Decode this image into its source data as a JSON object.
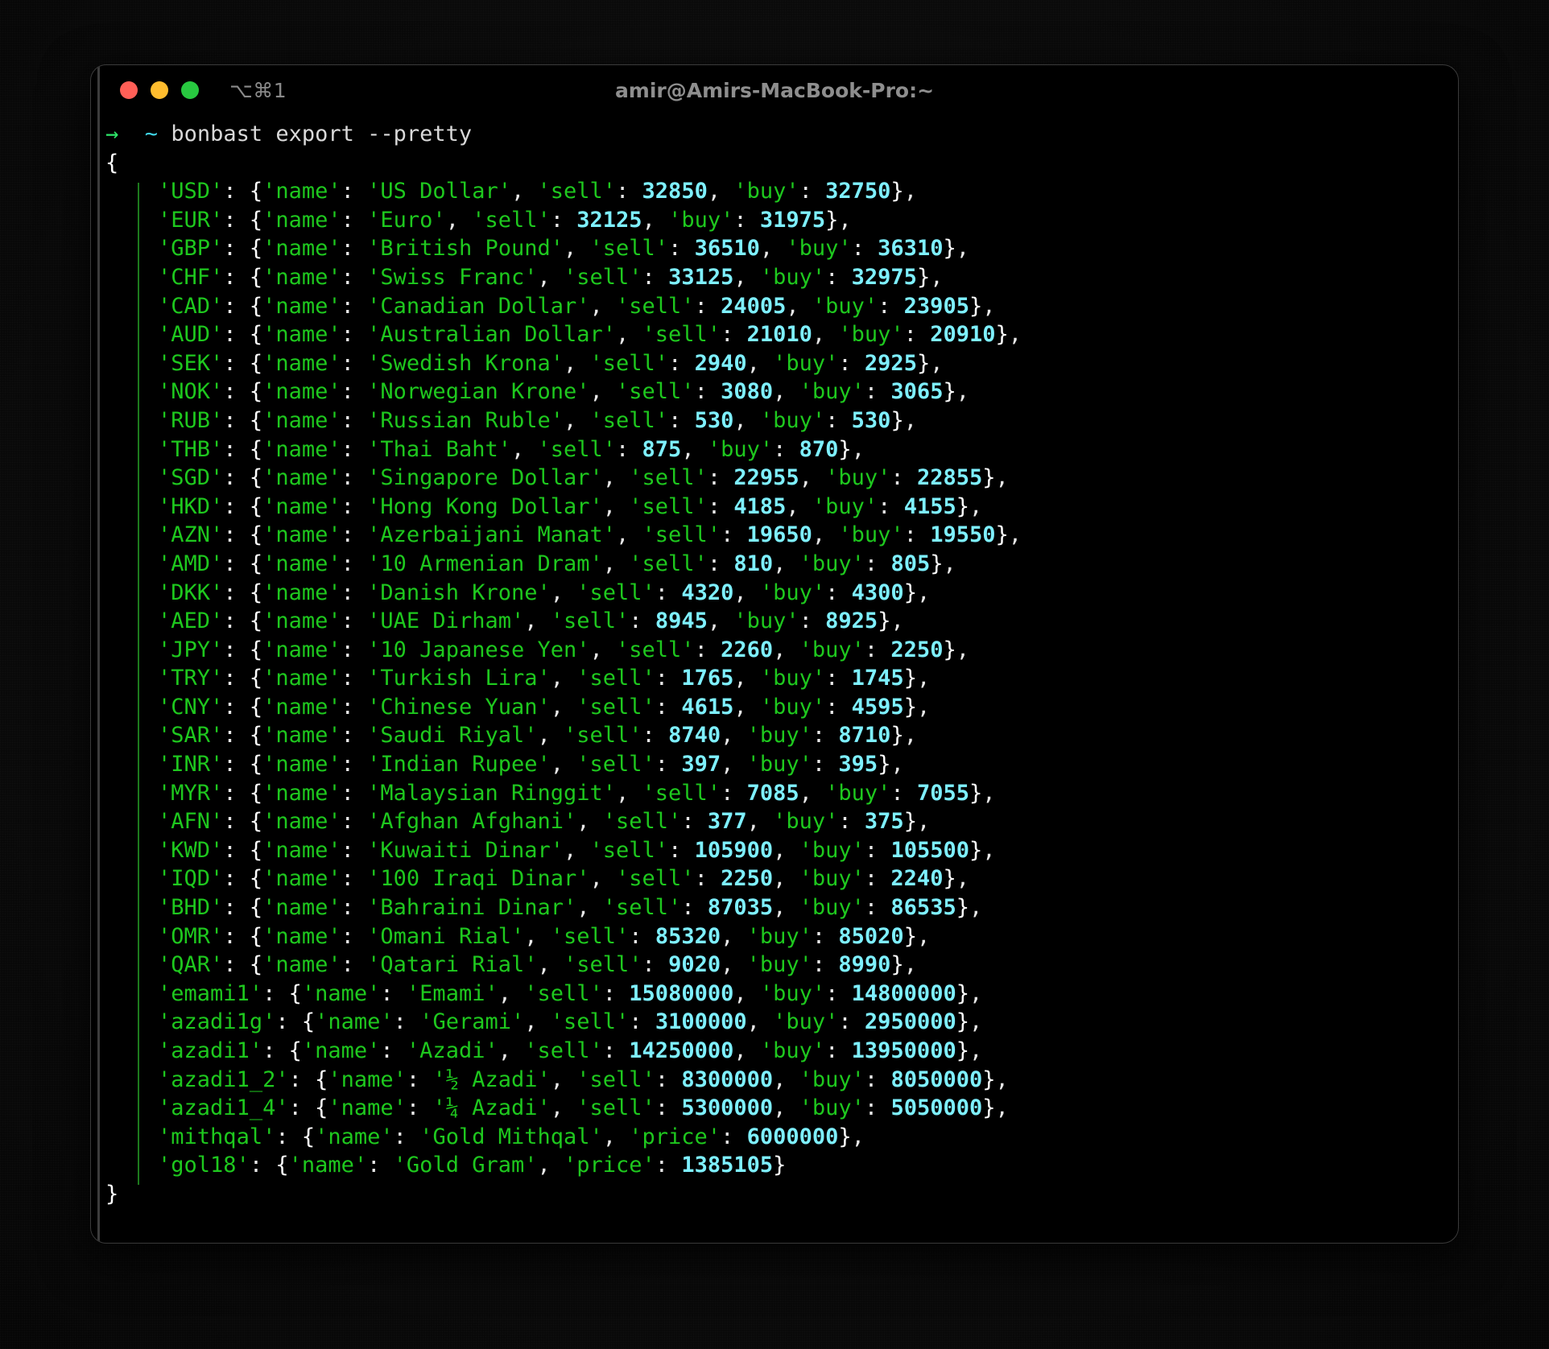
{
  "window": {
    "title": "amir@Amirs-MacBook-Pro:~",
    "shortcut_badge": "⌥⌘1",
    "traffic_lights": [
      {
        "name": "close",
        "color": "#FF5F57"
      },
      {
        "name": "minimize",
        "color": "#FEBC2E"
      },
      {
        "name": "zoom",
        "color": "#28C840"
      }
    ]
  },
  "prompt": {
    "arrow": "→",
    "cwd": "~",
    "command": "bonbast export --pretty"
  },
  "output": {
    "open_brace": "{",
    "close_brace": "}",
    "colors": {
      "string": "#1ec81e",
      "number": "#7ef0ff",
      "punctuation": "#ffffff",
      "background": "#000000",
      "indent_guide": "#1d7a1d"
    },
    "entries": [
      {
        "key": "USD",
        "name": "US Dollar",
        "sell": "32850",
        "buy": "32750"
      },
      {
        "key": "EUR",
        "name": "Euro",
        "sell": "32125",
        "buy": "31975"
      },
      {
        "key": "GBP",
        "name": "British Pound",
        "sell": "36510",
        "buy": "36310"
      },
      {
        "key": "CHF",
        "name": "Swiss Franc",
        "sell": "33125",
        "buy": "32975"
      },
      {
        "key": "CAD",
        "name": "Canadian Dollar",
        "sell": "24005",
        "buy": "23905"
      },
      {
        "key": "AUD",
        "name": "Australian Dollar",
        "sell": "21010",
        "buy": "20910"
      },
      {
        "key": "SEK",
        "name": "Swedish Krona",
        "sell": "2940",
        "buy": "2925"
      },
      {
        "key": "NOK",
        "name": "Norwegian Krone",
        "sell": "3080",
        "buy": "3065"
      },
      {
        "key": "RUB",
        "name": "Russian Ruble",
        "sell": "530",
        "buy": "530"
      },
      {
        "key": "THB",
        "name": "Thai Baht",
        "sell": "875",
        "buy": "870"
      },
      {
        "key": "SGD",
        "name": "Singapore Dollar",
        "sell": "22955",
        "buy": "22855"
      },
      {
        "key": "HKD",
        "name": "Hong Kong Dollar",
        "sell": "4185",
        "buy": "4155"
      },
      {
        "key": "AZN",
        "name": "Azerbaijani Manat",
        "sell": "19650",
        "buy": "19550"
      },
      {
        "key": "AMD",
        "name": "10 Armenian Dram",
        "sell": "810",
        "buy": "805"
      },
      {
        "key": "DKK",
        "name": "Danish Krone",
        "sell": "4320",
        "buy": "4300"
      },
      {
        "key": "AED",
        "name": "UAE Dirham",
        "sell": "8945",
        "buy": "8925"
      },
      {
        "key": "JPY",
        "name": "10 Japanese Yen",
        "sell": "2260",
        "buy": "2250"
      },
      {
        "key": "TRY",
        "name": "Turkish Lira",
        "sell": "1765",
        "buy": "1745"
      },
      {
        "key": "CNY",
        "name": "Chinese Yuan",
        "sell": "4615",
        "buy": "4595"
      },
      {
        "key": "SAR",
        "name": "Saudi Riyal",
        "sell": "8740",
        "buy": "8710"
      },
      {
        "key": "INR",
        "name": "Indian Rupee",
        "sell": "397",
        "buy": "395"
      },
      {
        "key": "MYR",
        "name": "Malaysian Ringgit",
        "sell": "7085",
        "buy": "7055"
      },
      {
        "key": "AFN",
        "name": "Afghan Afghani",
        "sell": "377",
        "buy": "375"
      },
      {
        "key": "KWD",
        "name": "Kuwaiti Dinar",
        "sell": "105900",
        "buy": "105500"
      },
      {
        "key": "IQD",
        "name": "100 Iraqi Dinar",
        "sell": "2250",
        "buy": "2240"
      },
      {
        "key": "BHD",
        "name": "Bahraini Dinar",
        "sell": "87035",
        "buy": "86535"
      },
      {
        "key": "OMR",
        "name": "Omani Rial",
        "sell": "85320",
        "buy": "85020"
      },
      {
        "key": "QAR",
        "name": "Qatari Rial",
        "sell": "9020",
        "buy": "8990"
      },
      {
        "key": "emami1",
        "name": "Emami",
        "sell": "15080000",
        "buy": "14800000"
      },
      {
        "key": "azadi1g",
        "name": "Gerami",
        "sell": "3100000",
        "buy": "2950000"
      },
      {
        "key": "azadi1",
        "name": "Azadi",
        "sell": "14250000",
        "buy": "13950000"
      },
      {
        "key": "azadi1_2",
        "name": "½ Azadi",
        "sell": "8300000",
        "buy": "8050000"
      },
      {
        "key": "azadi1_4",
        "name": "¼ Azadi",
        "sell": "5300000",
        "buy": "5050000"
      },
      {
        "key": "mithqal",
        "name": "Gold Mithqal",
        "price": "6000000"
      },
      {
        "key": "gol18",
        "name": "Gold Gram",
        "price": "1385105"
      }
    ]
  }
}
